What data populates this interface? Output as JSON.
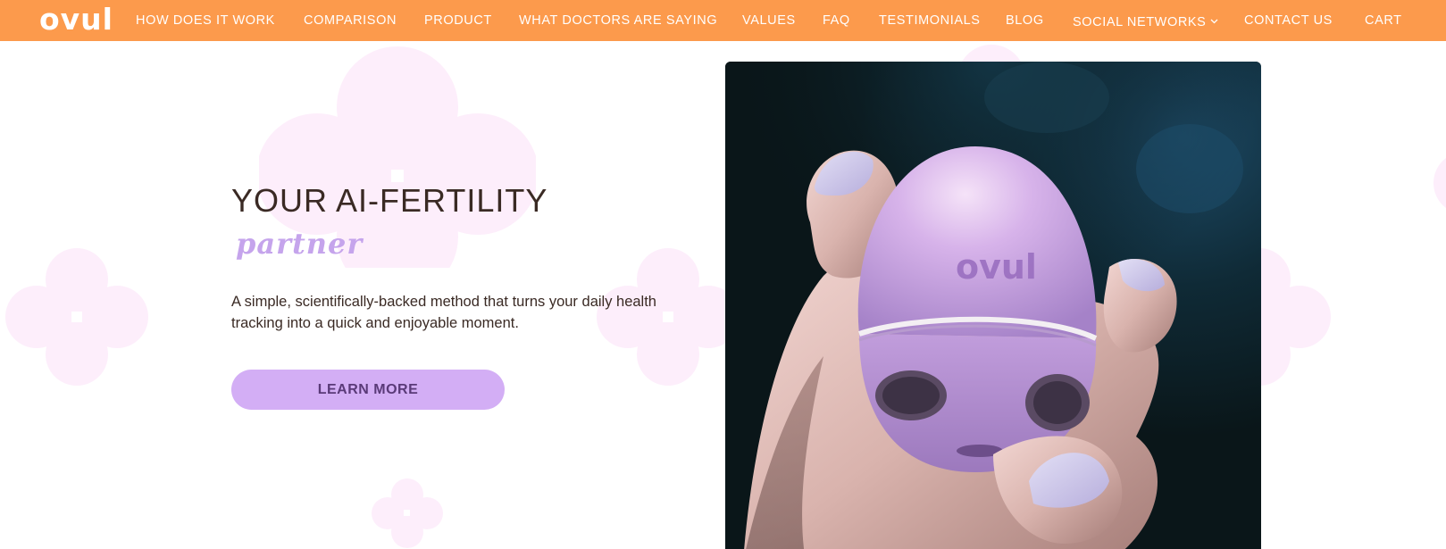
{
  "brand": {
    "logo_text": "ovul",
    "colors": {
      "nav_background": "#fc9a4c",
      "accent_purple": "#c5a4ec",
      "button_purple": "#d3aef5",
      "flower_pink": "#fdeefb",
      "text_dark": "#3a2a24"
    }
  },
  "nav": {
    "items": [
      {
        "label": "HOW DOES IT WORK"
      },
      {
        "label": "COMPARISON"
      },
      {
        "label": "PRODUCT"
      },
      {
        "label": "WHAT DOCTORS ARE SAYING"
      },
      {
        "label": "VALUES"
      },
      {
        "label": "FAQ"
      },
      {
        "label": "TESTIMONIALS"
      },
      {
        "label": "BLOG"
      },
      {
        "label": "SOCIAL NETWORKS",
        "icon": "chevron-down-icon"
      },
      {
        "label": "CONTACT US"
      },
      {
        "label": "CART"
      }
    ]
  },
  "hero": {
    "title": "YOUR AI-FERTILITY",
    "accent": "partner",
    "description": "A simple, scientifically-backed method that turns your daily health tracking into a quick and enjoyable moment.",
    "cta_label": "LEARN MORE"
  },
  "product_image": {
    "device_label": "ovul",
    "icon": "hand-holding-device-photo"
  }
}
